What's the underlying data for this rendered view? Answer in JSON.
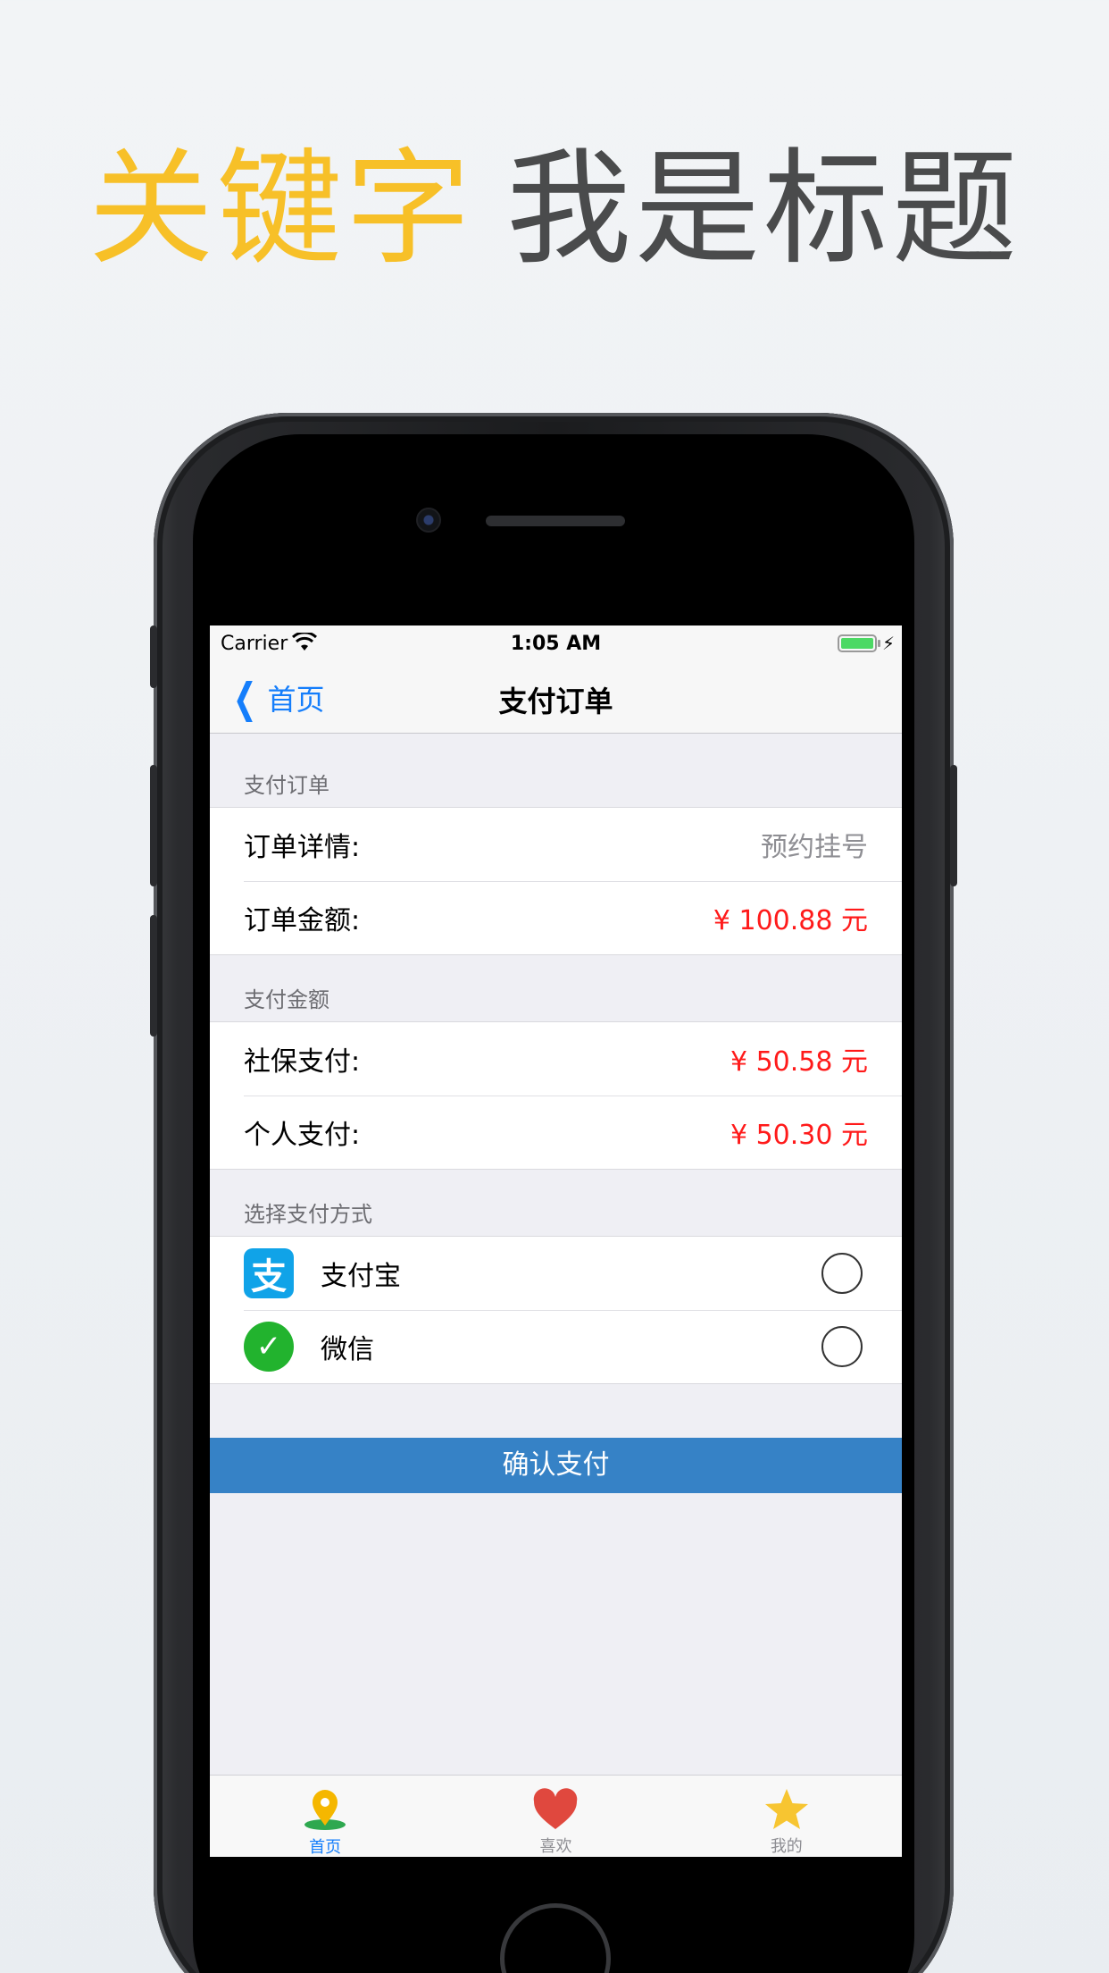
{
  "headline": {
    "keyword": "关键字",
    "title": "我是标题"
  },
  "status_bar": {
    "carrier": "Carrier",
    "time": "1:05 AM"
  },
  "nav": {
    "back_label": "首页",
    "title": "支付订单"
  },
  "sections": {
    "order": {
      "header": "支付订单",
      "rows": [
        {
          "label": "订单详情:",
          "value": "预约挂号"
        },
        {
          "label": "订单金额:",
          "value": "¥ 100.88 元"
        }
      ]
    },
    "amount": {
      "header": "支付金额",
      "rows": [
        {
          "label": "社保支付:",
          "value": "¥ 50.58 元"
        },
        {
          "label": "个人支付:",
          "value": "¥ 50.30 元"
        }
      ]
    },
    "method": {
      "header": "选择支付方式",
      "options": [
        {
          "label": "支付宝",
          "icon": "alipay-icon",
          "selected": false
        },
        {
          "label": "微信",
          "icon": "wechat-icon",
          "selected": false
        }
      ]
    }
  },
  "confirm_label": "确认支付",
  "tabs": [
    {
      "label": "首页",
      "icon": "location-pin-icon",
      "active": true
    },
    {
      "label": "喜欢",
      "icon": "heart-icon",
      "active": false
    },
    {
      "label": "我的",
      "icon": "star-icon",
      "active": false
    }
  ],
  "colors": {
    "keyword": "#f7c028",
    "accent": "#157efb",
    "amount_red": "#ff1a1a",
    "confirm_button": "#3682c6"
  }
}
